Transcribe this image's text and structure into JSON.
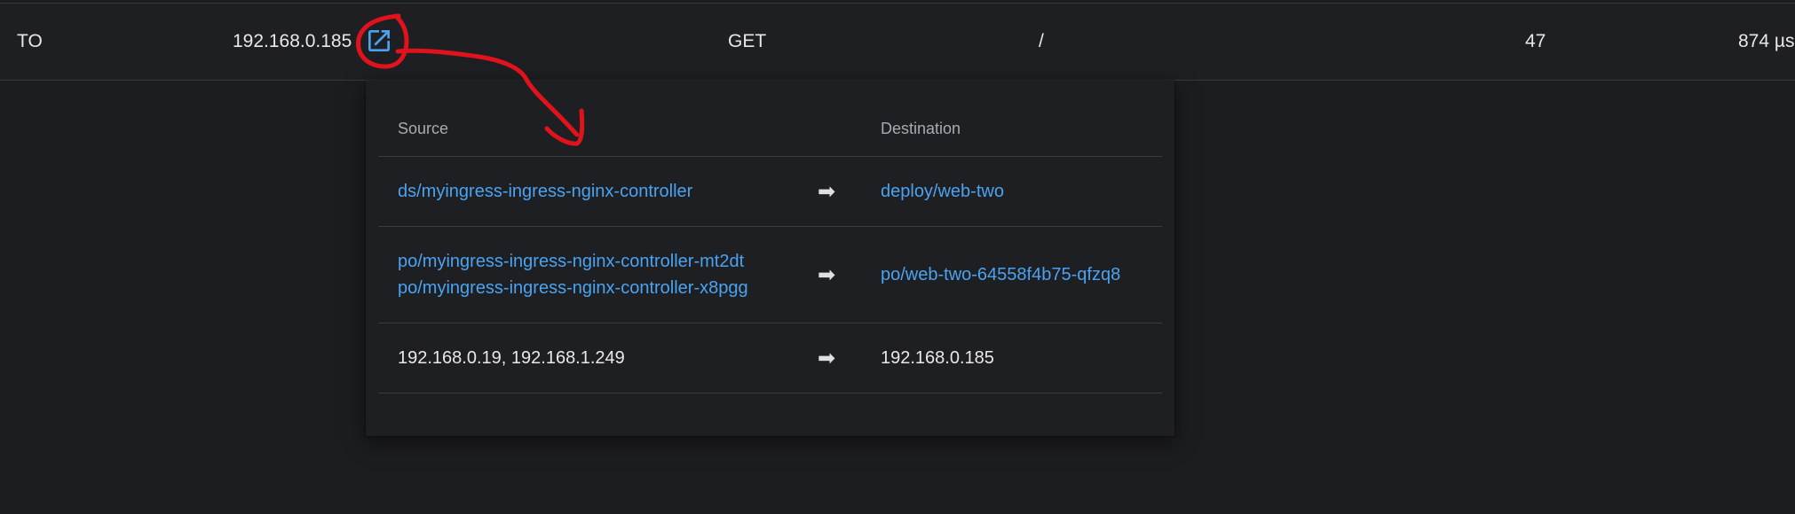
{
  "request_row": {
    "direction": "TO",
    "ip": "192.168.0.185",
    "method": "GET",
    "path": "/",
    "status": "47",
    "latency": "874 µs",
    "open_icon": "external-link-icon"
  },
  "popover": {
    "headers": {
      "source": "Source",
      "destination": "Destination"
    },
    "rows": [
      {
        "source": [
          "ds/myingress-ingress-nginx-controller"
        ],
        "arrow": "➡",
        "destination": [
          "deploy/web-two"
        ]
      },
      {
        "source": [
          "po/myingress-ingress-nginx-controller-mt2dt",
          "po/myingress-ingress-nginx-controller-x8pgg"
        ],
        "arrow": "➡",
        "destination": [
          "po/web-two-64558f4b75-qfzq8"
        ]
      },
      {
        "source": [
          "192.168.0.19, 192.168.1.249"
        ],
        "arrow": "➡",
        "destination": [
          "192.168.0.185"
        ]
      }
    ]
  },
  "colors": {
    "background": "#1c1d20",
    "link": "#4aa3f0",
    "annotation": "#e0121c"
  }
}
